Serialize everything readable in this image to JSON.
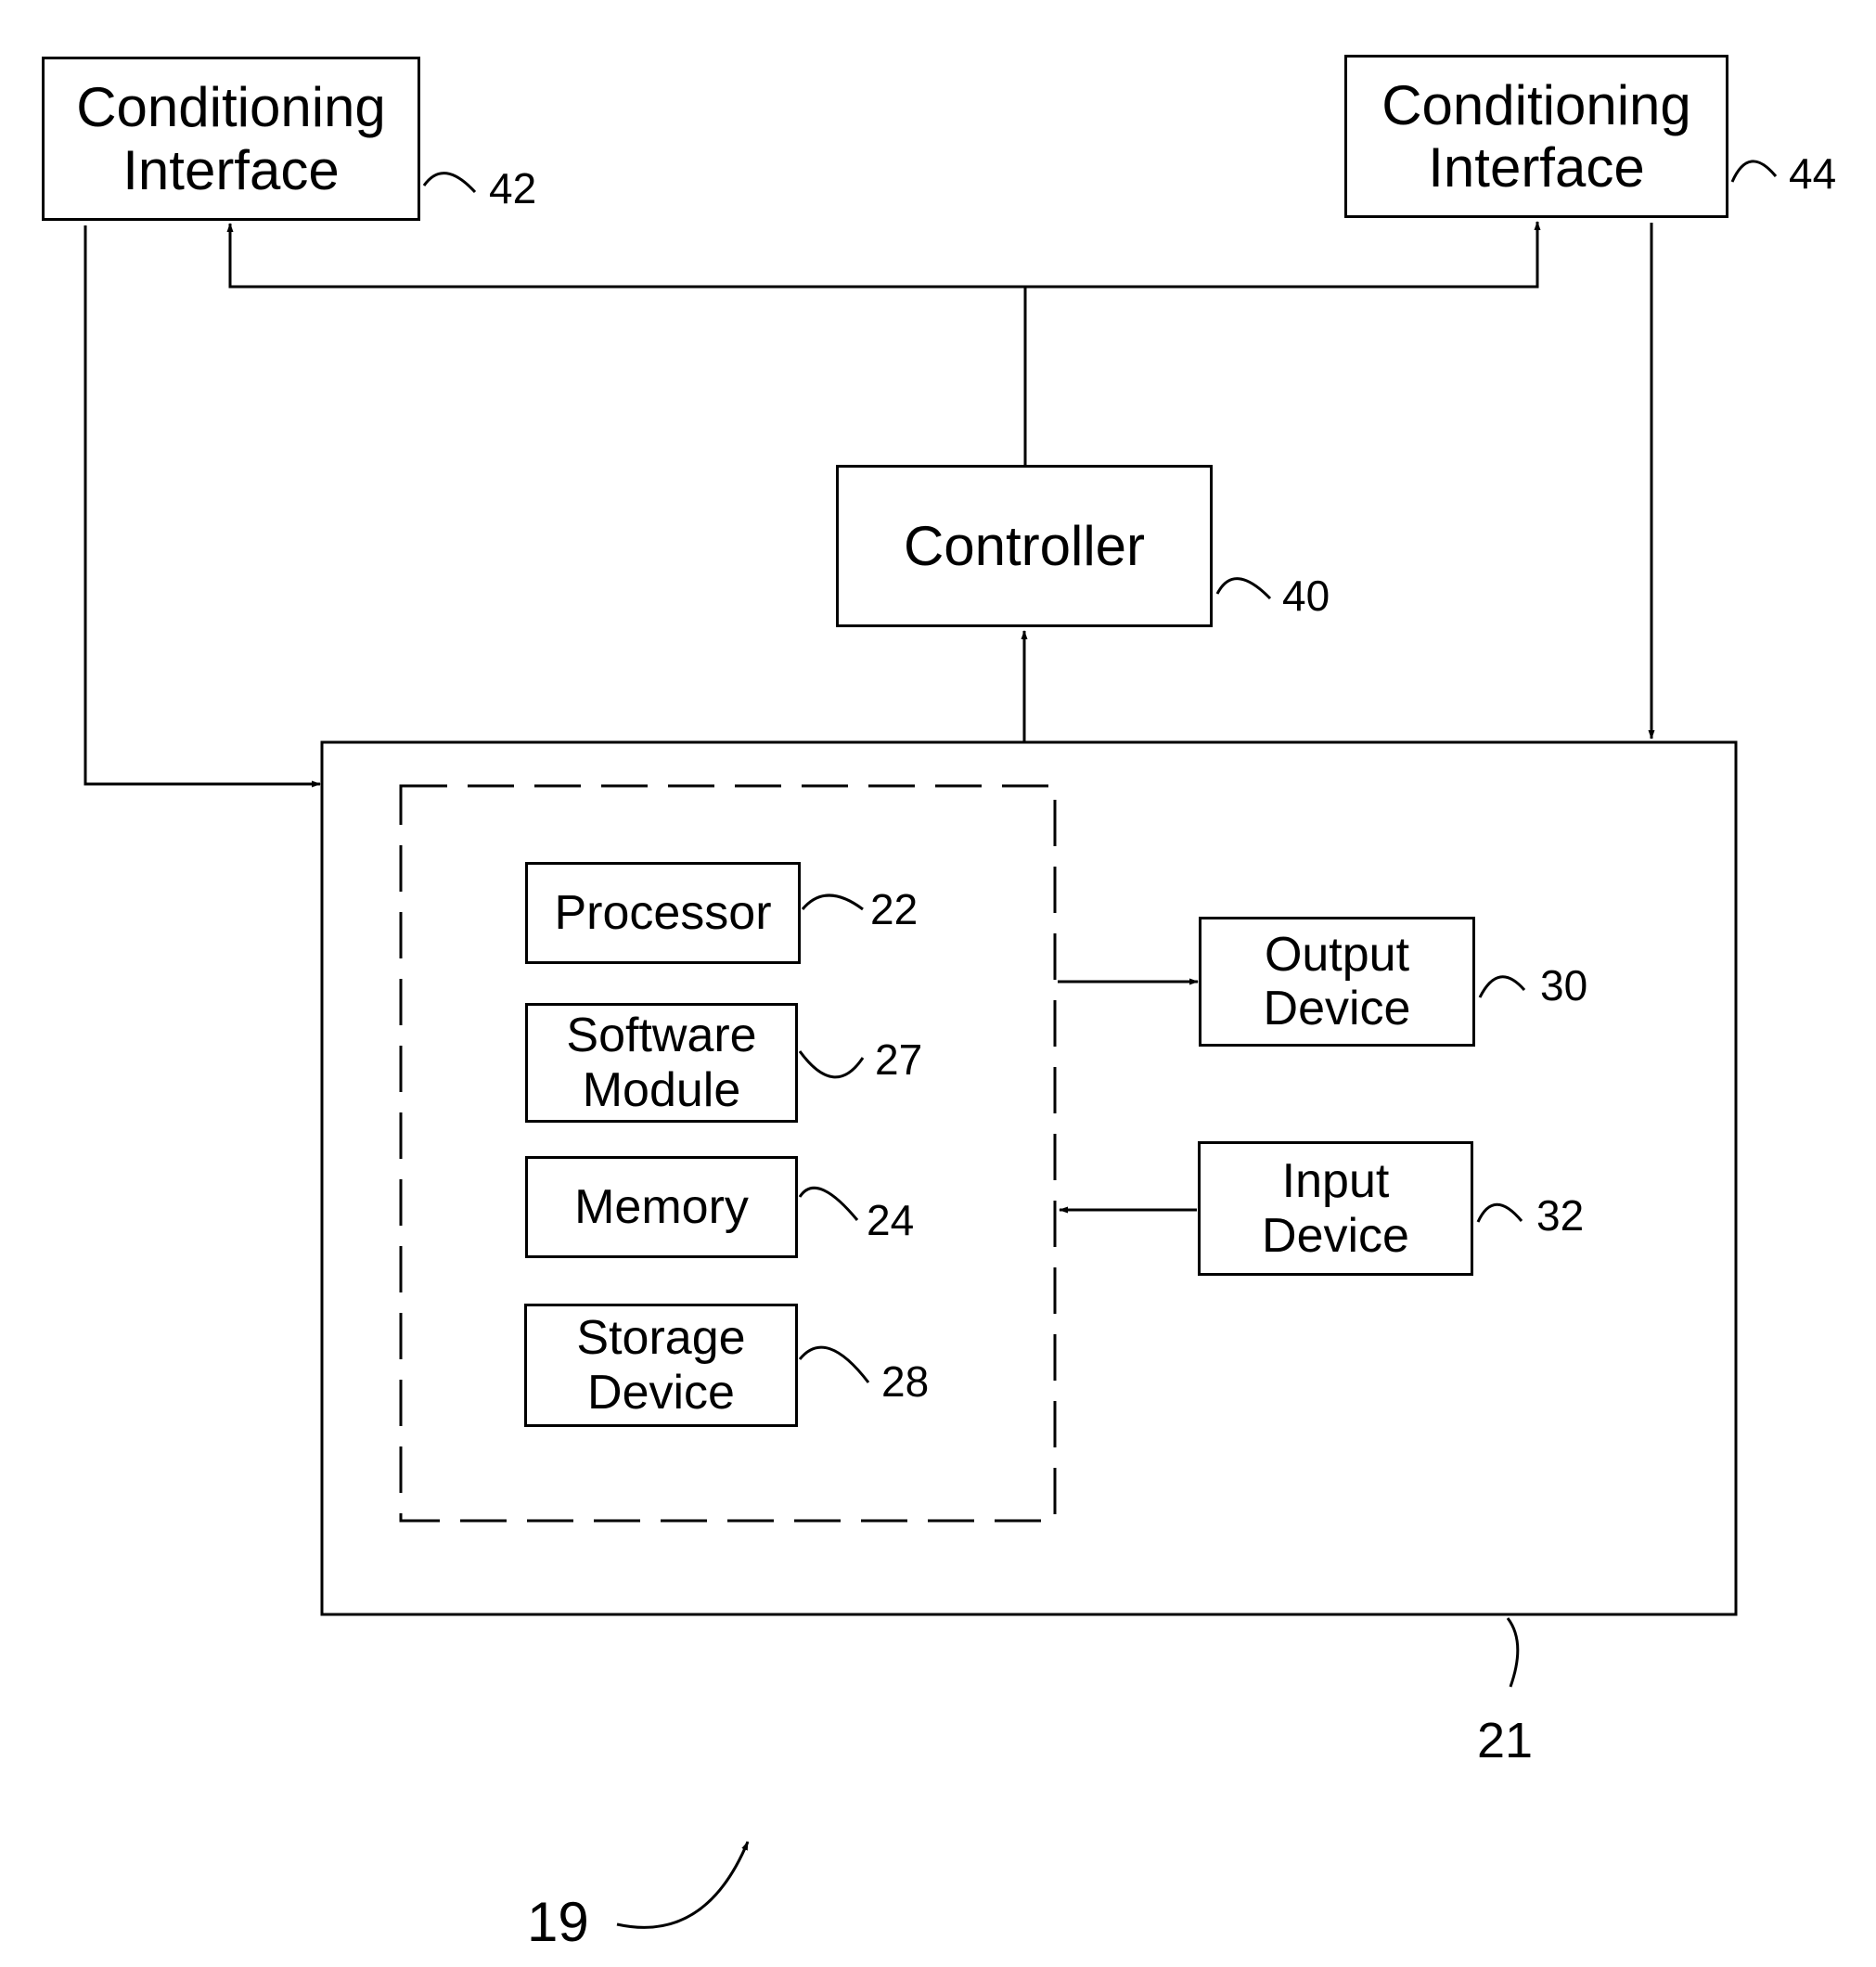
{
  "figure_number": "19",
  "blocks": {
    "conditioning_interface_left": {
      "label": "Conditioning\nInterface",
      "ref": "42"
    },
    "conditioning_interface_right": {
      "label": "Conditioning\nInterface",
      "ref": "44"
    },
    "controller": {
      "label": "Controller",
      "ref": "40"
    },
    "computing_device": {
      "ref": "21"
    },
    "processor": {
      "label": "Processor",
      "ref": "22"
    },
    "software_module": {
      "label": "Software\nModule",
      "ref": "27"
    },
    "memory": {
      "label": "Memory",
      "ref": "24"
    },
    "storage_device": {
      "label": "Storage\nDevice",
      "ref": "28"
    },
    "output_device": {
      "label": "Output\nDevice",
      "ref": "30"
    },
    "input_device": {
      "label": "Input\nDevice",
      "ref": "32"
    }
  },
  "connections": [
    {
      "from": "controller",
      "to": "conditioning_interface_left"
    },
    {
      "from": "controller",
      "to": "conditioning_interface_right"
    },
    {
      "from": "computing_device",
      "to": "controller"
    },
    {
      "from": "conditioning_interface_left",
      "to": "computing_device"
    },
    {
      "from": "conditioning_interface_right",
      "to": "computing_device"
    },
    {
      "from": "processing_group",
      "to": "output_device"
    },
    {
      "from": "input_device",
      "to": "processing_group"
    }
  ]
}
